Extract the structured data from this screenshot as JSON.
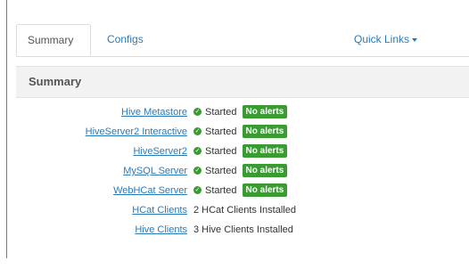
{
  "tabs": {
    "summary_label": "Summary",
    "configs_label": "Configs",
    "quick_links_label": "Quick Links"
  },
  "panel": {
    "title": "Summary"
  },
  "colors": {
    "link": "#2a7ab8",
    "status_green": "#3a9b33"
  },
  "components": [
    {
      "name": "Hive Metastore",
      "status": "Started",
      "badge": "No alerts",
      "icon": "check-circle-icon"
    },
    {
      "name": "HiveServer2 Interactive",
      "status": "Started",
      "badge": "No alerts",
      "icon": "check-circle-icon"
    },
    {
      "name": "HiveServer2",
      "status": "Started",
      "badge": "No alerts",
      "icon": "check-circle-icon"
    },
    {
      "name": "MySQL Server",
      "status": "Started",
      "badge": "No alerts",
      "icon": "check-circle-icon"
    },
    {
      "name": "WebHCat Server",
      "status": "Started",
      "badge": "No alerts",
      "icon": "check-circle-icon"
    }
  ],
  "clients": [
    {
      "name": "HCat Clients",
      "info": "2 HCat Clients Installed"
    },
    {
      "name": "Hive Clients",
      "info": "3 Hive Clients Installed"
    }
  ]
}
